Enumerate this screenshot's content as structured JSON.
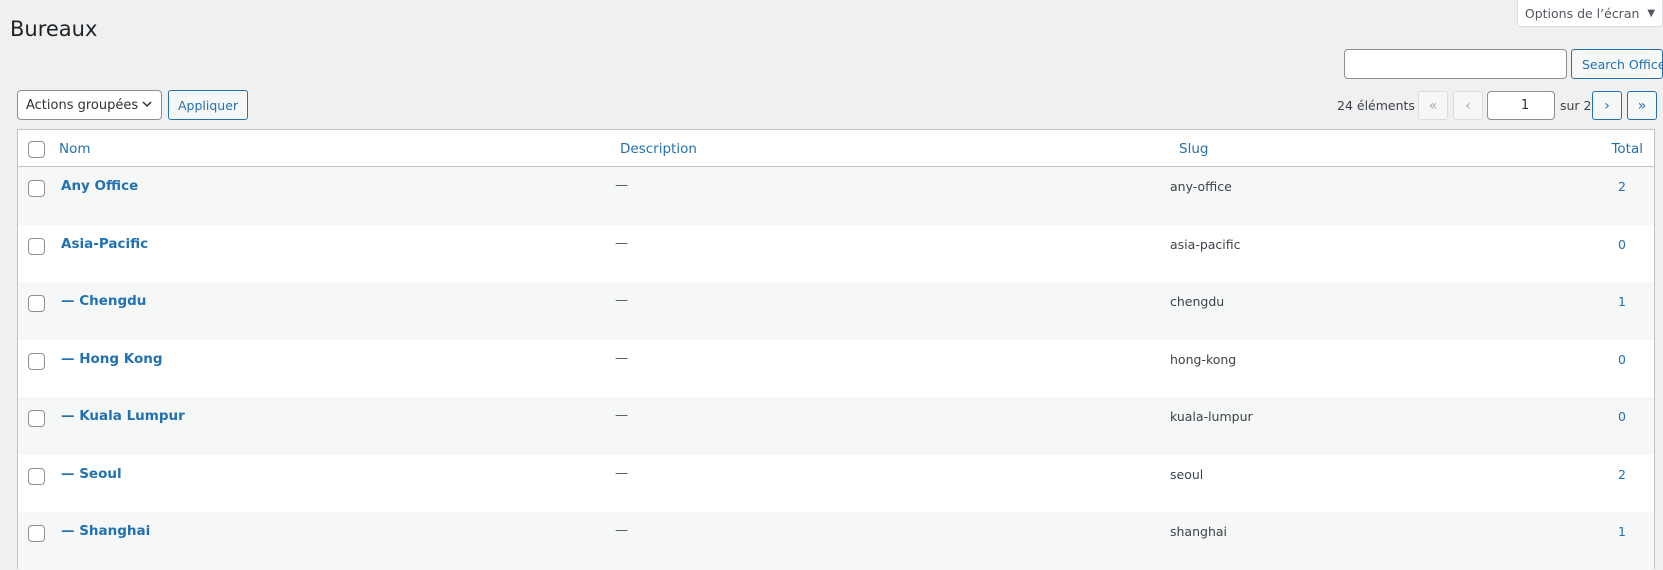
{
  "screen_options": {
    "label": "Options de l’écran",
    "arrow": "▼"
  },
  "page": {
    "title": "Bureaux"
  },
  "search": {
    "value": "",
    "button_label": "Search Office"
  },
  "bulk_actions": {
    "selected": "Actions groupées",
    "apply_label": "Appliquer"
  },
  "pagination": {
    "items_count": "24 éléments",
    "first": "«",
    "prev": "‹",
    "current_page": "1",
    "of_total": "sur 2",
    "next": "›",
    "last": "»"
  },
  "table": {
    "columns": {
      "name": "Nom",
      "description": "Description",
      "slug": "Slug",
      "total": "Total"
    },
    "rows": [
      {
        "name": "Any Office",
        "description": "—",
        "slug": "any-office",
        "total": "2"
      },
      {
        "name": "Asia-Pacific",
        "description": "—",
        "slug": "asia-pacific",
        "total": "0"
      },
      {
        "name": "— Chengdu",
        "description": "—",
        "slug": "chengdu",
        "total": "1"
      },
      {
        "name": "— Hong Kong",
        "description": "—",
        "slug": "hong-kong",
        "total": "0"
      },
      {
        "name": "— Kuala Lumpur",
        "description": "—",
        "slug": "kuala-lumpur",
        "total": "0"
      },
      {
        "name": "— Seoul",
        "description": "—",
        "slug": "seoul",
        "total": "2"
      },
      {
        "name": "— Shanghai",
        "description": "—",
        "slug": "shanghai",
        "total": "1"
      }
    ]
  },
  "colors": {
    "link": "#2271b1",
    "background": "#f0f0f1",
    "row_alt": "#f6f7f7"
  }
}
